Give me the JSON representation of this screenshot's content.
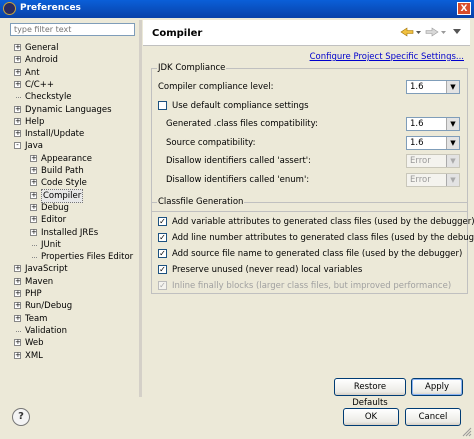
{
  "window": {
    "title": "Preferences",
    "close_glyph": "X"
  },
  "filter": {
    "placeholder": "type filter text"
  },
  "tree": [
    {
      "label": "General",
      "exp": "+"
    },
    {
      "label": "Android",
      "exp": "+"
    },
    {
      "label": "Ant",
      "exp": "+"
    },
    {
      "label": "C/C++",
      "exp": "+"
    },
    {
      "label": "Checkstyle",
      "exp": ""
    },
    {
      "label": "Dynamic Languages",
      "exp": "+"
    },
    {
      "label": "Help",
      "exp": "+"
    },
    {
      "label": "Install/Update",
      "exp": "+"
    },
    {
      "label": "Java",
      "exp": "-"
    },
    {
      "label": "Appearance",
      "exp": "+"
    },
    {
      "label": "Build Path",
      "exp": "+"
    },
    {
      "label": "Code Style",
      "exp": "+"
    },
    {
      "label": "Compiler",
      "exp": "+"
    },
    {
      "label": "Debug",
      "exp": "+"
    },
    {
      "label": "Editor",
      "exp": "+"
    },
    {
      "label": "Installed JREs",
      "exp": "+"
    },
    {
      "label": "JUnit",
      "exp": ""
    },
    {
      "label": "Properties Files Editor",
      "exp": ""
    },
    {
      "label": "JavaScript",
      "exp": "+"
    },
    {
      "label": "Maven",
      "exp": "+"
    },
    {
      "label": "PHP",
      "exp": "+"
    },
    {
      "label": "Run/Debug",
      "exp": "+"
    },
    {
      "label": "Team",
      "exp": "+"
    },
    {
      "label": "Validation",
      "exp": ""
    },
    {
      "label": "Web",
      "exp": "+"
    },
    {
      "label": "XML",
      "exp": "+"
    }
  ],
  "page": {
    "title": "Compiler",
    "configure_link": "Configure Project Specific Settings..."
  },
  "jdk": {
    "group_label": "JDK Compliance",
    "compliance_label": "Compiler compliance level:",
    "compliance_value": "1.6",
    "use_default_label": "Use default compliance settings",
    "use_default_checked": false,
    "generated_label": "Generated .class files compatibility:",
    "generated_value": "1.6",
    "source_label": "Source compatibility:",
    "source_value": "1.6",
    "assert_label": "Disallow identifiers called 'assert':",
    "assert_value": "Error",
    "enum_label": "Disallow identifiers called 'enum':",
    "enum_value": "Error"
  },
  "classfile": {
    "group_label": "Classfile Generation",
    "options": [
      {
        "label": "Add variable attributes to generated class files (used by the debugger)",
        "checked": true,
        "enabled": true
      },
      {
        "label": "Add line number attributes to generated class files (used by the debugger)",
        "checked": true,
        "enabled": true
      },
      {
        "label": "Add source file name to generated class file (used by the debugger)",
        "checked": true,
        "enabled": true
      },
      {
        "label": "Preserve unused (never read) local variables",
        "checked": true,
        "enabled": true
      },
      {
        "label": "Inline finally blocks (larger class files, but improved performance)",
        "checked": true,
        "enabled": false
      }
    ]
  },
  "buttons": {
    "restore_defaults": "Restore Defaults",
    "apply": "Apply",
    "ok": "OK",
    "cancel": "Cancel",
    "help_glyph": "?"
  },
  "icons": {
    "back": "back-arrow-icon",
    "forward": "forward-arrow-icon",
    "menu": "view-menu-icon",
    "help": "help-icon"
  },
  "colors": {
    "title_bar": "#0a5fd8",
    "link": "#0000cc",
    "window_bg": "#ece9d8"
  }
}
